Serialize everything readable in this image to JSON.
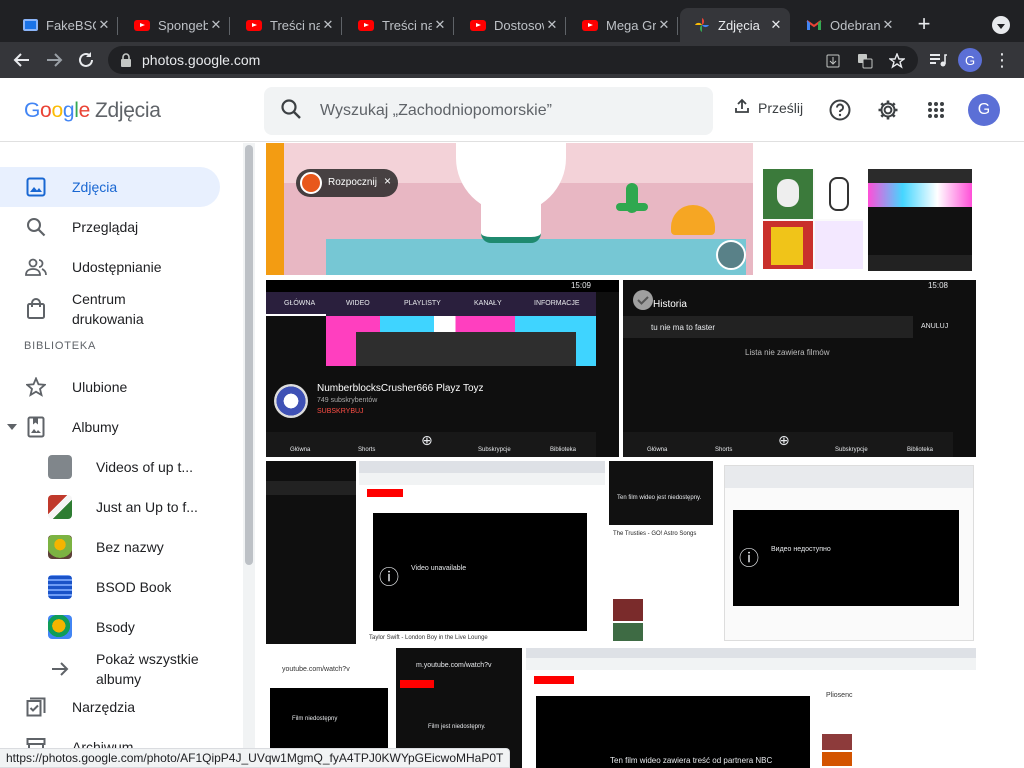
{
  "browser": {
    "tabs": [
      {
        "title": "FakeBSOD",
        "icon": "computer-icon",
        "active": false
      },
      {
        "title": "Spongebob",
        "icon": "youtube-icon",
        "active": false
      },
      {
        "title": "Treści na",
        "icon": "youtube-icon",
        "active": false
      },
      {
        "title": "Treści na",
        "icon": "youtube-icon",
        "active": false
      },
      {
        "title": "Dostosowanie",
        "icon": "youtube-icon",
        "active": false
      },
      {
        "title": "Mega Gry",
        "icon": "youtube-icon",
        "active": false
      },
      {
        "title": "Zdjęcia",
        "icon": "google-photos-icon",
        "active": true
      },
      {
        "title": "Odebrane",
        "icon": "gmail-icon",
        "active": false
      }
    ],
    "new_tab": "+",
    "url": "photos.google.com",
    "profile_initial": "G",
    "status_url": "https://photos.google.com/photo/AF1QipP4J_UVqw1MgmQ_fyA4TPJ0KWYpGEicwoMHaP0T"
  },
  "header": {
    "logo_letters": [
      "G",
      "o",
      "o",
      "g",
      "l",
      "e"
    ],
    "product": "Zdjęcia",
    "search_placeholder": "Wyszukaj „Zachodniopomorskie”",
    "upload_label": "Prześlij",
    "avatar_initial": "G"
  },
  "sidebar": {
    "nav": [
      {
        "label": "Zdjęcia",
        "icon": "photo-icon",
        "active": true
      },
      {
        "label": "Przeglądaj",
        "icon": "search-icon",
        "active": false
      },
      {
        "label": "Udostępnianie",
        "icon": "people-icon",
        "active": false
      },
      {
        "label": "Centrum drukowania",
        "icon": "shopping-bag-icon",
        "active": false
      }
    ],
    "section_label": "BIBLIOTEKA",
    "library": [
      {
        "label": "Ulubione",
        "icon": "star-icon"
      },
      {
        "label": "Albumy",
        "icon": "album-icon"
      }
    ],
    "albums": [
      {
        "label": "Videos of up t...",
        "color": "#80868b"
      },
      {
        "label": "Just an Up to f...",
        "color": "#c0392b"
      },
      {
        "label": "Bez nazwy",
        "color": "#7cb342"
      },
      {
        "label": "BSOD Book",
        "color": "#1a53c8"
      },
      {
        "label": "Bsody",
        "color": "#f4b400"
      }
    ],
    "show_all": "Pokaż wszystkie albumy",
    "tools": "Narzędzia",
    "archive": "Archiwum"
  },
  "photos": {
    "row1_game": {
      "button": "Rozpocznij",
      "close": "×"
    },
    "row2_left": {
      "time": "15:09",
      "tabs": [
        "GŁÓWNA",
        "WIDEO",
        "PLAYLISTY",
        "KANAŁY",
        "INFORMACJE"
      ],
      "channel": "NumberblocksCrusher666 Playz Toyz",
      "subs": "749 subskrybentów",
      "subscribe": "SUBSKRYBUJ",
      "bottom_nav": [
        "Główna",
        "Shorts",
        "",
        "Subskrypcje",
        "Biblioteka"
      ]
    },
    "row2_right": {
      "time": "15:08",
      "title": "Historia",
      "query": "tu nie ma to faster",
      "cancel": "ANULUJ",
      "empty": "Lista nie zawiera filmów",
      "bottom_nav": [
        "Główna",
        "Shorts",
        "",
        "Subskrypcje",
        "Biblioteka"
      ]
    },
    "row3_b": {
      "error": "Video unavailable",
      "caption": "Taylor Swift - London Boy in the Live Lounge"
    },
    "row3_c": {
      "msg": "Ten film wideo jest niedostępny.",
      "channel": "The Trusties - GO! Astro Songs"
    },
    "row3_d": {
      "msg": "Видео недоступно"
    },
    "row4_a": {
      "url": "youtube.com/watch?v",
      "msg": "Film niedostępny"
    },
    "row4_b": {
      "url": "m.youtube.com/watch?v",
      "msg": "Film jest niedostępny."
    },
    "row4_c": {
      "msg": "Ten film wideo zawiera treść od partnera NBC",
      "side_title": "Pliosenc"
    }
  }
}
